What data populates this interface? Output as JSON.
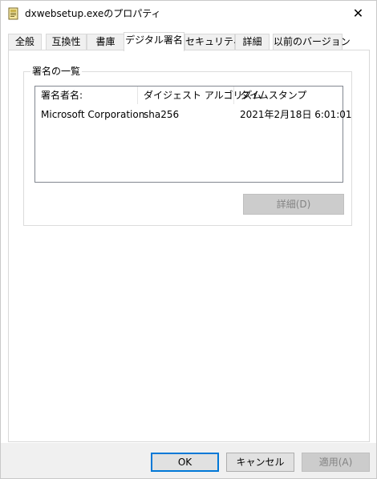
{
  "window": {
    "title": "dxwebsetup.exeのプロパティ",
    "close_glyph": "✕"
  },
  "tabs": [
    {
      "label": "全般",
      "active": false
    },
    {
      "label": "互換性",
      "active": false
    },
    {
      "label": "書庫",
      "active": false
    },
    {
      "label": "デジタル署名",
      "active": true
    },
    {
      "label": "セキュリティ",
      "active": false
    },
    {
      "label": "詳細",
      "active": false
    },
    {
      "label": "以前のバージョン",
      "active": false
    }
  ],
  "signature_group": {
    "label": "署名の一覧",
    "columns": [
      "署名者名:",
      "ダイジェスト アルゴリズム",
      "タイムスタンプ"
    ],
    "rows": [
      [
        "Microsoft Corporation",
        "sha256",
        "2021年2月18日 6:01:01"
      ]
    ],
    "details_button": "詳細(D)"
  },
  "footer": {
    "ok": "OK",
    "cancel": "キャンセル",
    "apply": "適用(A)"
  },
  "colors": {
    "accent": "#0078d7",
    "disabled_text": "#838383",
    "footer_bg": "#f0f0f0"
  }
}
